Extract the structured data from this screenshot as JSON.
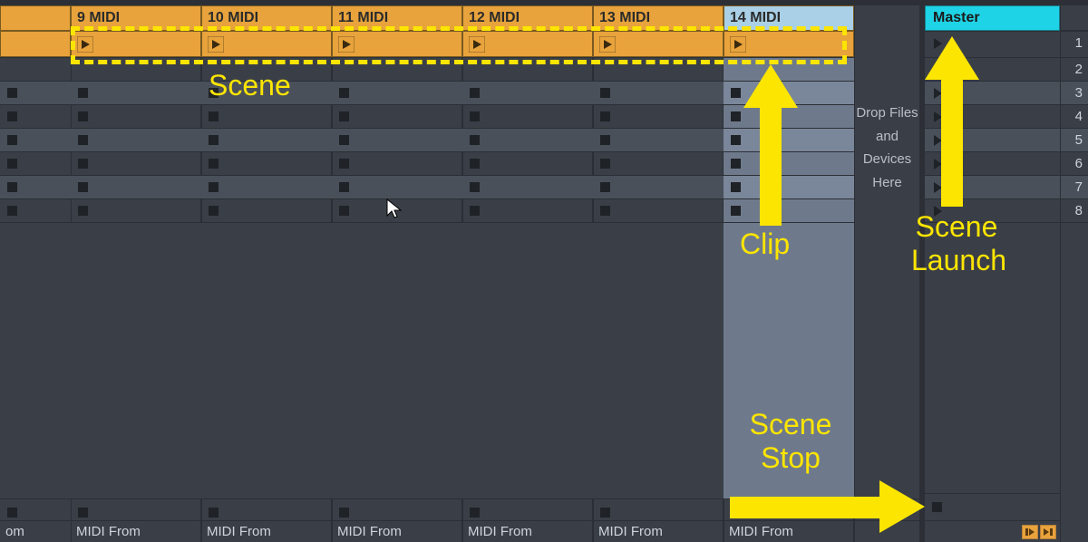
{
  "tracks": [
    {
      "name": "9 MIDI",
      "footer": "MIDI From"
    },
    {
      "name": "10 MIDI",
      "footer": "MIDI From"
    },
    {
      "name": "11 MIDI",
      "footer": "MIDI From"
    },
    {
      "name": "12 MIDI",
      "footer": "MIDI From"
    },
    {
      "name": "13 MIDI",
      "footer": "MIDI From"
    },
    {
      "name": "14 MIDI",
      "footer": "MIDI From",
      "selected": true
    }
  ],
  "partial_track_footer": "om",
  "master": {
    "title": "Master"
  },
  "scene_numbers": [
    "1",
    "2",
    "3",
    "4",
    "5",
    "6",
    "7",
    "8"
  ],
  "drop_text": {
    "l1": "Drop Files",
    "l2": "and Devices",
    "l3": "Here"
  },
  "annotations": {
    "scene": "Scene",
    "clip": "Clip",
    "scene_launch": "Scene Launch",
    "scene_stop": "Scene Stop"
  }
}
